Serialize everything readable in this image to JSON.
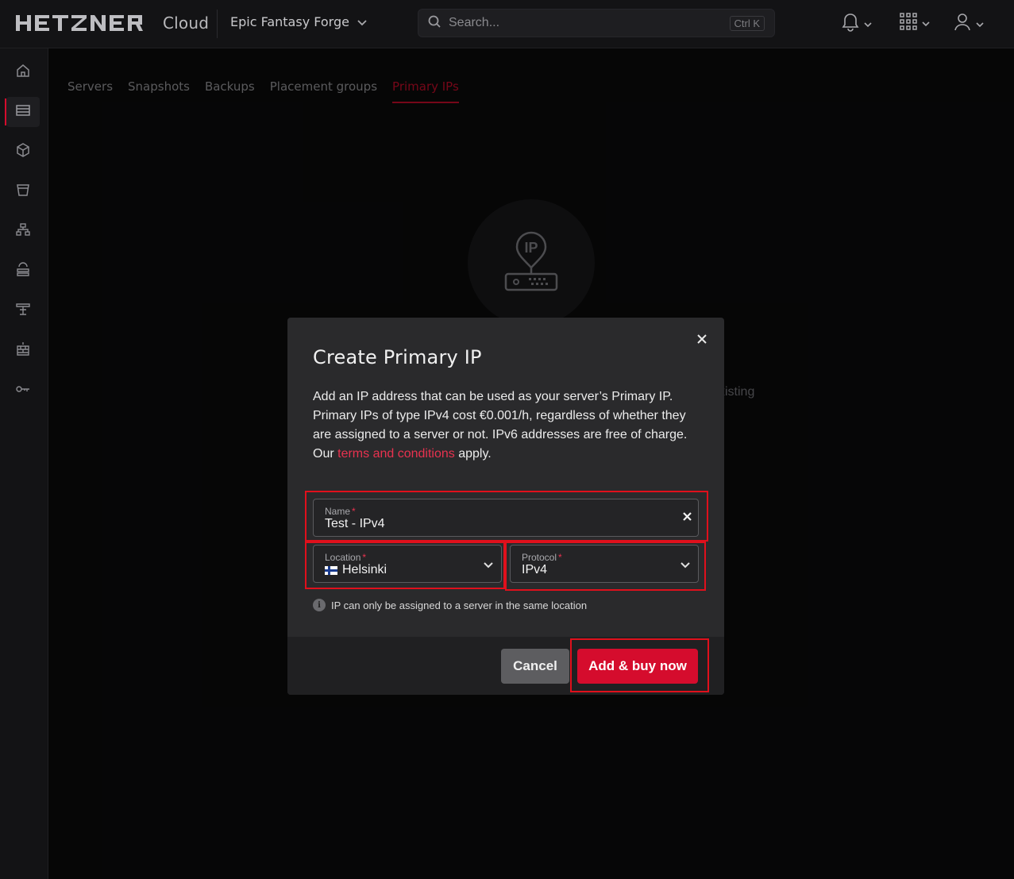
{
  "header": {
    "brand": "HETZNER",
    "product": "Cloud",
    "project": "Epic Fantasy Forge",
    "search_placeholder": "Search...",
    "search_shortcut": "Ctrl K"
  },
  "sidebar": {
    "items": [
      {
        "icon": "home-icon"
      },
      {
        "icon": "servers-icon",
        "active": true
      },
      {
        "icon": "volumes-icon"
      },
      {
        "icon": "storage-bucket-icon"
      },
      {
        "icon": "network-icon"
      },
      {
        "icon": "load-balancer-icon"
      },
      {
        "icon": "floating-ip-icon"
      },
      {
        "icon": "firewall-icon"
      },
      {
        "icon": "ssh-key-icon"
      }
    ]
  },
  "tabs": [
    {
      "label": "Servers"
    },
    {
      "label": "Snapshots"
    },
    {
      "label": "Backups"
    },
    {
      "label": "Placement groups"
    },
    {
      "label": "Primary IPs",
      "active": true
    }
  ],
  "background": {
    "empty_icon_text": "IP",
    "partial_text": "xisting"
  },
  "modal": {
    "title": "Create Primary IP",
    "description": "Add an IP address that can be used as your server’s Primary IP. Primary IPs of type IPv4 cost €0.001/h, regardless of whether they are assigned to a server or not. IPv6 addresses are free of charge.",
    "terms_prefix": "Our ",
    "terms_link": "terms and conditions",
    "terms_suffix": " apply.",
    "name_field": {
      "label": "Name",
      "required": "*",
      "value": "Test - IPv4"
    },
    "location_field": {
      "label": "Location",
      "required": "*",
      "value": "Helsinki"
    },
    "protocol_field": {
      "label": "Protocol",
      "required": "*",
      "value": "IPv4"
    },
    "info_text": "IP can only be assigned to a server in the same location",
    "cancel_label": "Cancel",
    "submit_label": "Add & buy now"
  },
  "colors": {
    "accent": "#d50c2d",
    "highlight": "#e0101c"
  }
}
